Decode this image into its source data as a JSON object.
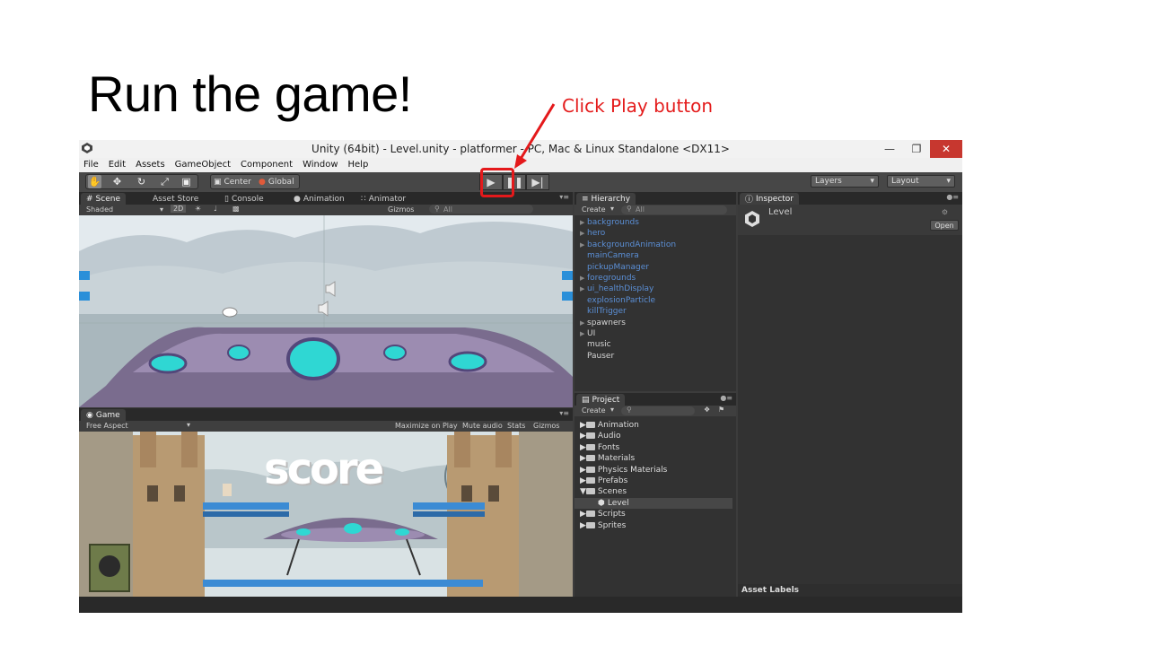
{
  "slide": {
    "title": "Run the game!",
    "annotation": "Click Play button"
  },
  "window": {
    "title": "Unity (64bit) - Level.unity - platformer - PC, Mac & Linux Standalone <DX11>",
    "menu": [
      "File",
      "Edit",
      "Assets",
      "GameObject",
      "Component",
      "Window",
      "Help"
    ]
  },
  "toolbar": {
    "pivot": "Center",
    "space": "Global",
    "layers": "Layers",
    "layout": "Layout"
  },
  "scene_panel": {
    "tabs": [
      "Scene",
      "Asset Store",
      "Console",
      "Animation",
      "Animator"
    ],
    "shading": "Shaded",
    "mode_2d": "2D",
    "gizmos": "Gizmos",
    "search_placeholder": "All"
  },
  "game_panel": {
    "tab": "Game",
    "aspect": "Free Aspect",
    "maximize": "Maximize on Play",
    "mute": "Mute audio",
    "stats": "Stats",
    "gizmos": "Gizmos",
    "score_text": "score"
  },
  "hierarchy": {
    "tab": "Hierarchy",
    "create": "Create",
    "search_placeholder": "All",
    "items": [
      {
        "label": "backgrounds",
        "expandable": true,
        "color": "#5b8fd6"
      },
      {
        "label": "hero",
        "expandable": true,
        "color": "#5b8fd6"
      },
      {
        "label": "backgroundAnimation",
        "expandable": true,
        "color": "#5b8fd6"
      },
      {
        "label": "mainCamera",
        "expandable": false,
        "color": "#5b8fd6"
      },
      {
        "label": "pickupManager",
        "expandable": false,
        "color": "#5b8fd6"
      },
      {
        "label": "foregrounds",
        "expandable": true,
        "color": "#5b8fd6"
      },
      {
        "label": "ui_healthDisplay",
        "expandable": true,
        "color": "#5b8fd6"
      },
      {
        "label": "explosionParticle",
        "expandable": false,
        "color": "#5b8fd6"
      },
      {
        "label": "killTrigger",
        "expandable": false,
        "color": "#5b8fd6"
      },
      {
        "label": "spawners",
        "expandable": true,
        "color": "#d4d4d4"
      },
      {
        "label": "UI",
        "expandable": true,
        "color": "#d4d4d4"
      },
      {
        "label": "music",
        "expandable": false,
        "color": "#d4d4d4"
      },
      {
        "label": "Pauser",
        "expandable": false,
        "color": "#d4d4d4"
      }
    ]
  },
  "project": {
    "tab": "Project",
    "create": "Create",
    "items": [
      {
        "label": "Animation",
        "type": "folder"
      },
      {
        "label": "Audio",
        "type": "folder"
      },
      {
        "label": "Fonts",
        "type": "folder"
      },
      {
        "label": "Materials",
        "type": "folder"
      },
      {
        "label": "Physics Materials",
        "type": "folder"
      },
      {
        "label": "Prefabs",
        "type": "folder"
      },
      {
        "label": "Scenes",
        "type": "folder-open"
      },
      {
        "label": "Level",
        "type": "scene",
        "selected": true
      },
      {
        "label": "Scripts",
        "type": "folder"
      },
      {
        "label": "Sprites",
        "type": "folder"
      }
    ]
  },
  "inspector": {
    "tab": "Inspector",
    "object_name": "Level",
    "open_button": "Open",
    "asset_labels": "Asset Labels"
  }
}
